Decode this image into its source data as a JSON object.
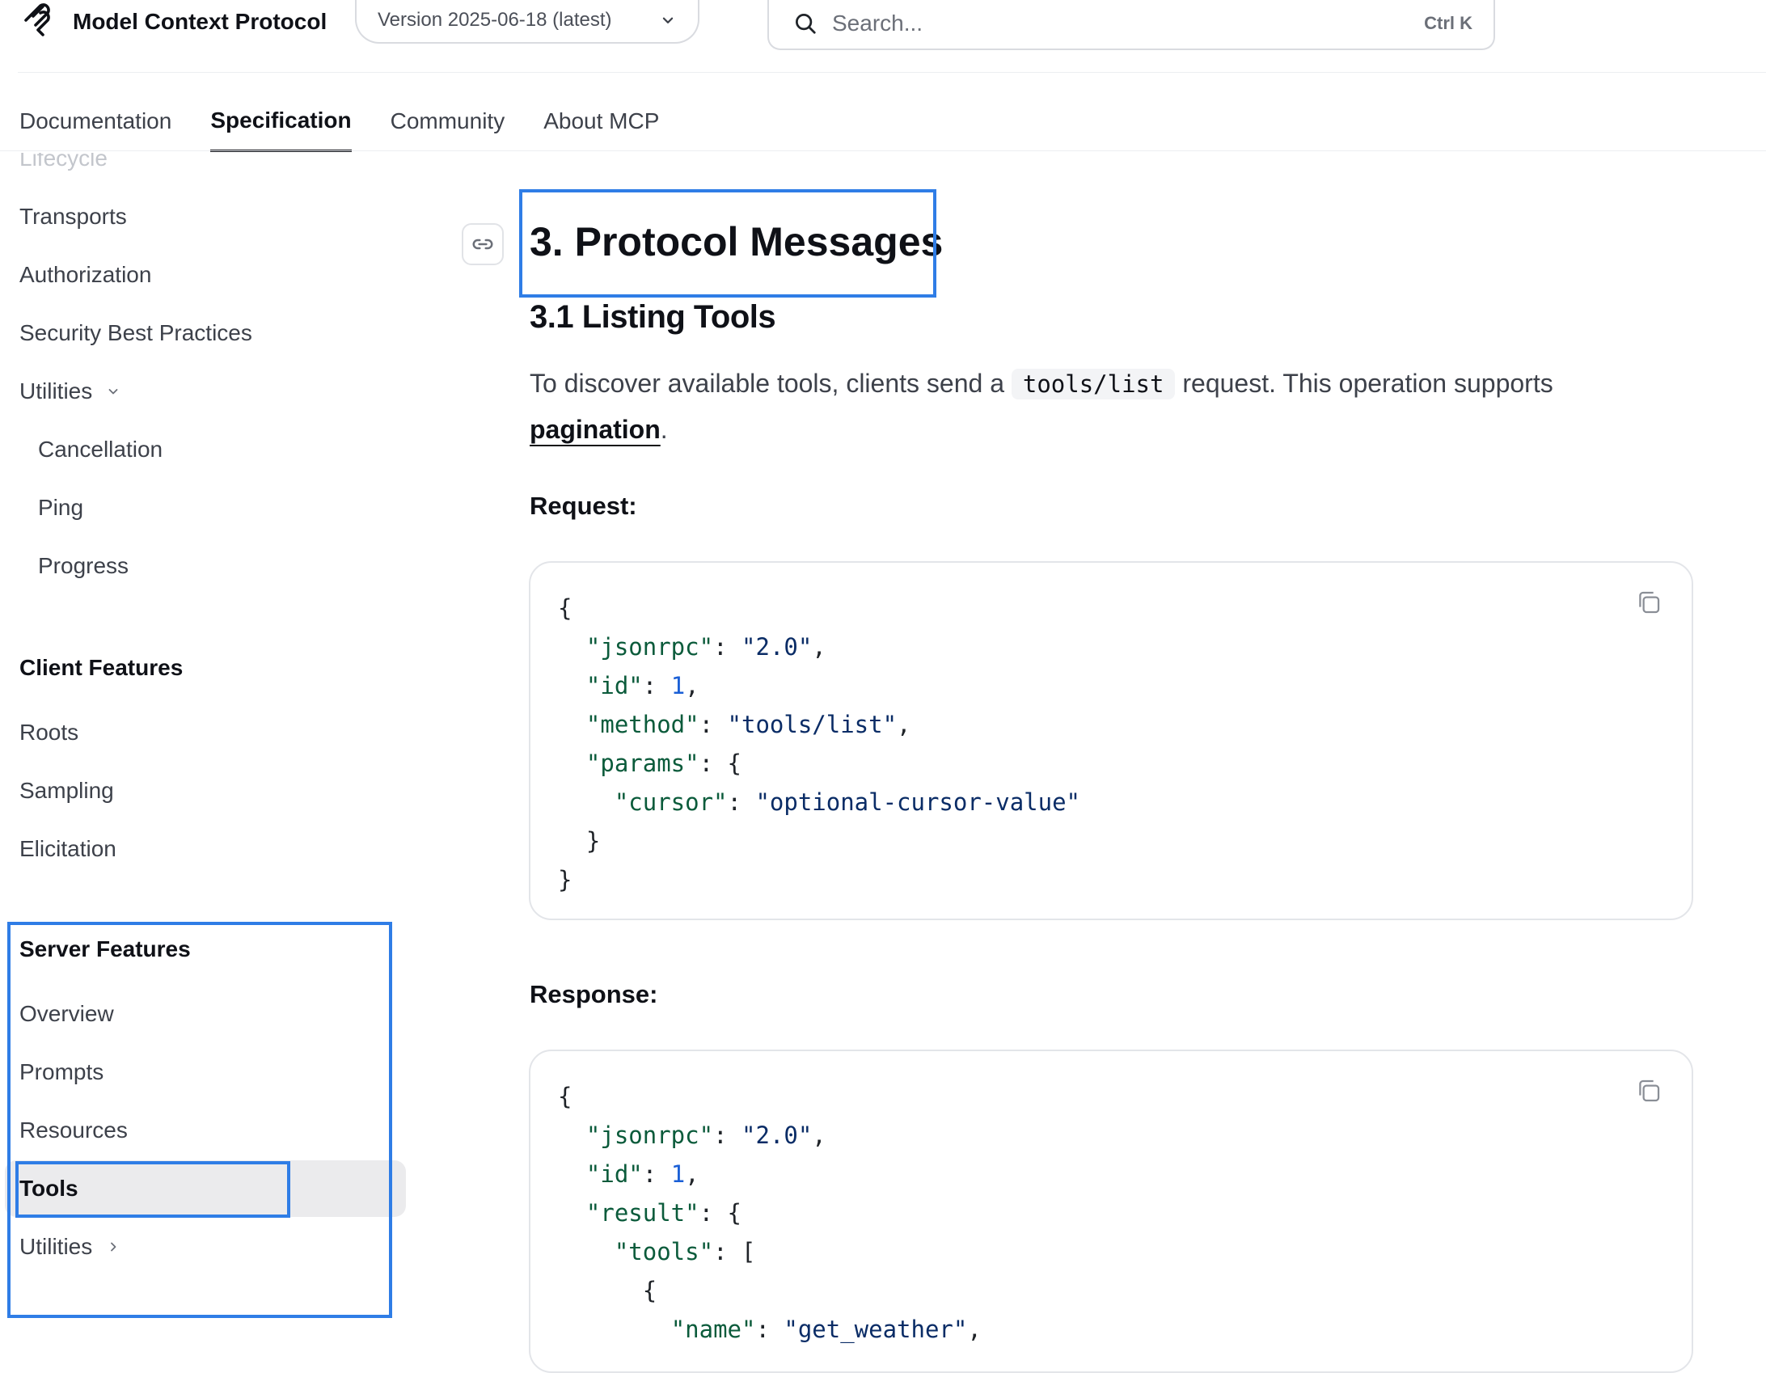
{
  "header": {
    "logo_text": "Model Context Protocol",
    "version_label": "Version 2025-06-18 (latest)",
    "search_placeholder": "Search...",
    "search_shortcut": "Ctrl K"
  },
  "nav_tabs": [
    {
      "label": "Documentation",
      "active": false
    },
    {
      "label": "Specification",
      "active": true
    },
    {
      "label": "Community",
      "active": false
    },
    {
      "label": "About MCP",
      "active": false
    }
  ],
  "sidebar": {
    "partial_item": "Lifecycle",
    "base_items": [
      "Transports",
      "Authorization",
      "Security Best Practices"
    ],
    "utilities_label": "Utilities",
    "utilities_children": [
      "Cancellation",
      "Ping",
      "Progress"
    ],
    "client_features": {
      "heading": "Client Features",
      "items": [
        "Roots",
        "Sampling",
        "Elicitation"
      ]
    },
    "server_features": {
      "heading": "Server Features",
      "items": [
        "Overview",
        "Prompts",
        "Resources",
        "Tools"
      ],
      "active_item": "Tools",
      "utilities_label": "Utilities"
    }
  },
  "content": {
    "heading": "3. Protocol Messages",
    "subheading": "3.1 Listing Tools",
    "paragraph": {
      "before_code": "To discover available tools, clients send a ",
      "code": "tools/list",
      "after_code": " request. This operation supports ",
      "link": "pagination",
      "end": "."
    },
    "request_label": "Request:",
    "response_label": "Response:",
    "request_code": [
      [
        {
          "t": "p",
          "v": "{"
        }
      ],
      [
        {
          "t": "p",
          "v": "  "
        },
        {
          "t": "k",
          "v": "\"jsonrpc\""
        },
        {
          "t": "p",
          "v": ": "
        },
        {
          "t": "s",
          "v": "\"2.0\""
        },
        {
          "t": "p",
          "v": ","
        }
      ],
      [
        {
          "t": "p",
          "v": "  "
        },
        {
          "t": "k",
          "v": "\"id\""
        },
        {
          "t": "p",
          "v": ": "
        },
        {
          "t": "n",
          "v": "1"
        },
        {
          "t": "p",
          "v": ","
        }
      ],
      [
        {
          "t": "p",
          "v": "  "
        },
        {
          "t": "k",
          "v": "\"method\""
        },
        {
          "t": "p",
          "v": ": "
        },
        {
          "t": "s",
          "v": "\"tools/list\""
        },
        {
          "t": "p",
          "v": ","
        }
      ],
      [
        {
          "t": "p",
          "v": "  "
        },
        {
          "t": "k",
          "v": "\"params\""
        },
        {
          "t": "p",
          "v": ": {"
        }
      ],
      [
        {
          "t": "p",
          "v": "    "
        },
        {
          "t": "k",
          "v": "\"cursor\""
        },
        {
          "t": "p",
          "v": ": "
        },
        {
          "t": "s",
          "v": "\"optional-cursor-value\""
        }
      ],
      [
        {
          "t": "p",
          "v": "  }"
        }
      ],
      [
        {
          "t": "p",
          "v": "}"
        }
      ]
    ],
    "response_code": [
      [
        {
          "t": "p",
          "v": "{"
        }
      ],
      [
        {
          "t": "p",
          "v": "  "
        },
        {
          "t": "k",
          "v": "\"jsonrpc\""
        },
        {
          "t": "p",
          "v": ": "
        },
        {
          "t": "s",
          "v": "\"2.0\""
        },
        {
          "t": "p",
          "v": ","
        }
      ],
      [
        {
          "t": "p",
          "v": "  "
        },
        {
          "t": "k",
          "v": "\"id\""
        },
        {
          "t": "p",
          "v": ": "
        },
        {
          "t": "n",
          "v": "1"
        },
        {
          "t": "p",
          "v": ","
        }
      ],
      [
        {
          "t": "p",
          "v": "  "
        },
        {
          "t": "k",
          "v": "\"result\""
        },
        {
          "t": "p",
          "v": ": {"
        }
      ],
      [
        {
          "t": "p",
          "v": "    "
        },
        {
          "t": "k",
          "v": "\"tools\""
        },
        {
          "t": "p",
          "v": ": ["
        }
      ],
      [
        {
          "t": "p",
          "v": "      {"
        }
      ],
      [
        {
          "t": "p",
          "v": "        "
        },
        {
          "t": "k",
          "v": "\"name\""
        },
        {
          "t": "p",
          "v": ": "
        },
        {
          "t": "s",
          "v": "\"get_weather\""
        },
        {
          "t": "p",
          "v": ","
        }
      ]
    ]
  },
  "colors": {
    "highlight_box": "#2f7de6",
    "active_sidebar_bg": "#ebebed",
    "json_key": "#0b5b3b",
    "json_string": "#0a2c66",
    "json_number": "#1a5fd6"
  }
}
